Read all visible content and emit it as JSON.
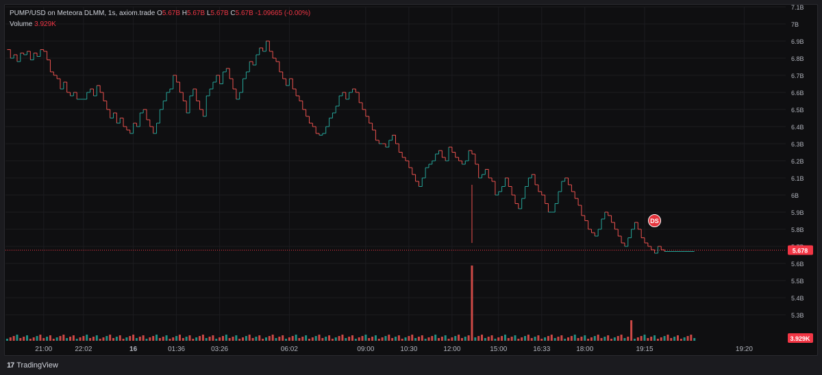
{
  "legend": {
    "symbol": "PUMP/USD on Meteora DLMM, 1s, axiom.trade",
    "o_label": "O",
    "o_val": "5.67B",
    "h_label": "H",
    "h_val": "5.67B",
    "l_label": "L",
    "l_val": "5.67B",
    "c_label": "C",
    "c_val": "5.67B",
    "change": "-1.09665 (-0.00%)",
    "volume_label": "Volume",
    "volume_val": "3.929K"
  },
  "marker": {
    "label": "DS"
  },
  "footer": {
    "brand": "TradingView",
    "logo": "17"
  },
  "colors": {
    "up": "#26a69a",
    "down": "#ef5350",
    "price_tag": "#f23645",
    "grid": "#1c1c20",
    "axis_text": "#b2b5be"
  },
  "chart_data": {
    "type": "line",
    "title": "",
    "ylabel": "",
    "xlabel": "",
    "ylim": [
      5.2,
      7.1
    ],
    "y_unit": "B",
    "last_price": 5.678,
    "last_price_label": "5.678",
    "volume_tag": "3.929K",
    "y_ticks": [
      "7.1B",
      "7B",
      "6.9B",
      "6.8B",
      "6.7B",
      "6.6B",
      "6.5B",
      "6.4B",
      "6.3B",
      "6.2B",
      "6.1B",
      "6B",
      "5.9B",
      "5.8B",
      "5.7B",
      "5.6B",
      "5.5B",
      "5.4B",
      "5.3B"
    ],
    "y_tick_values": [
      7.1,
      7.0,
      6.9,
      6.8,
      6.7,
      6.6,
      6.5,
      6.4,
      6.3,
      6.2,
      6.1,
      6.0,
      5.9,
      5.8,
      5.7,
      5.6,
      5.5,
      5.4,
      5.3
    ],
    "x_ticks": [
      "21:00",
      "22:02",
      "16",
      "01:36",
      "03:26",
      "06:02",
      "09:00",
      "10:30",
      "12:00",
      "15:00",
      "16:33",
      "18:00",
      "19:15",
      "19:20"
    ],
    "x_tick_bold": [
      false,
      false,
      true,
      false,
      false,
      false,
      false,
      false,
      false,
      false,
      false,
      false,
      false,
      false
    ],
    "x_tick_index": [
      11,
      23,
      38,
      51,
      64,
      85,
      108,
      121,
      134,
      148,
      161,
      174,
      192,
      222
    ],
    "n": 235,
    "series": [
      {
        "values": [
          6.85,
          6.8,
          6.82,
          6.78,
          6.83,
          6.82,
          6.84,
          6.79,
          6.83,
          6.81,
          6.85,
          6.84,
          6.79,
          6.72,
          6.7,
          6.68,
          6.62,
          6.66,
          6.6,
          6.58,
          6.6,
          6.56,
          6.56,
          6.56,
          6.6,
          6.62,
          6.58,
          6.64,
          6.6,
          6.55,
          6.5,
          6.45,
          6.48,
          6.42,
          6.45,
          6.4,
          6.38,
          6.36,
          6.42,
          6.4,
          6.48,
          6.5,
          6.44,
          6.4,
          6.36,
          6.42,
          6.5,
          6.55,
          6.6,
          6.62,
          6.7,
          6.66,
          6.6,
          6.55,
          6.48,
          6.58,
          6.62,
          6.55,
          6.5,
          6.46,
          6.58,
          6.62,
          6.66,
          6.7,
          6.65,
          6.72,
          6.74,
          6.68,
          6.62,
          6.56,
          6.6,
          6.68,
          6.72,
          6.78,
          6.76,
          6.82,
          6.86,
          6.84,
          6.9,
          6.84,
          6.8,
          6.78,
          6.72,
          6.68,
          6.64,
          6.68,
          6.62,
          6.58,
          6.55,
          6.5,
          6.46,
          6.42,
          6.4,
          6.36,
          6.35,
          6.36,
          6.4,
          6.45,
          6.48,
          6.52,
          6.58,
          6.6,
          6.56,
          6.6,
          6.62,
          6.6,
          6.54,
          6.5,
          6.46,
          6.42,
          6.38,
          6.32,
          6.3,
          6.3,
          6.28,
          6.32,
          6.35,
          6.3,
          6.25,
          6.22,
          6.2,
          6.16,
          6.12,
          6.08,
          6.05,
          6.1,
          6.16,
          6.18,
          6.2,
          6.24,
          6.26,
          6.22,
          6.2,
          6.28,
          6.25,
          6.22,
          6.2,
          6.18,
          6.2,
          6.26,
          6.24,
          6.18,
          6.1,
          6.12,
          6.15,
          6.1,
          6.08,
          6.0,
          6.02,
          6.05,
          6.1,
          6.05,
          6.0,
          5.95,
          5.92,
          5.98,
          6.05,
          6.1,
          6.12,
          6.06,
          6.02,
          6.0,
          5.95,
          5.9,
          5.9,
          5.95,
          6.02,
          6.08,
          6.1,
          6.06,
          6.02,
          5.98,
          5.94,
          5.88,
          5.85,
          5.8,
          5.78,
          5.76,
          5.8,
          5.86,
          5.9,
          5.88,
          5.84,
          5.8,
          5.76,
          5.72,
          5.7,
          5.75,
          5.8,
          5.84,
          5.8,
          5.75,
          5.72,
          5.7,
          5.68,
          5.66,
          5.7,
          5.68,
          5.67,
          5.67,
          5.67,
          5.67,
          5.67,
          5.67,
          5.67,
          5.67,
          5.67,
          5.67,
          5.67,
          5.67,
          5.67,
          5.67,
          5.67,
          5.67,
          5.67,
          5.67,
          5.67,
          5.67,
          5.67,
          5.67,
          5.67,
          5.67,
          5.67,
          5.67,
          5.67,
          5.67,
          5.67,
          5.67,
          5.67,
          5.67,
          5.67
        ]
      }
    ]
  }
}
